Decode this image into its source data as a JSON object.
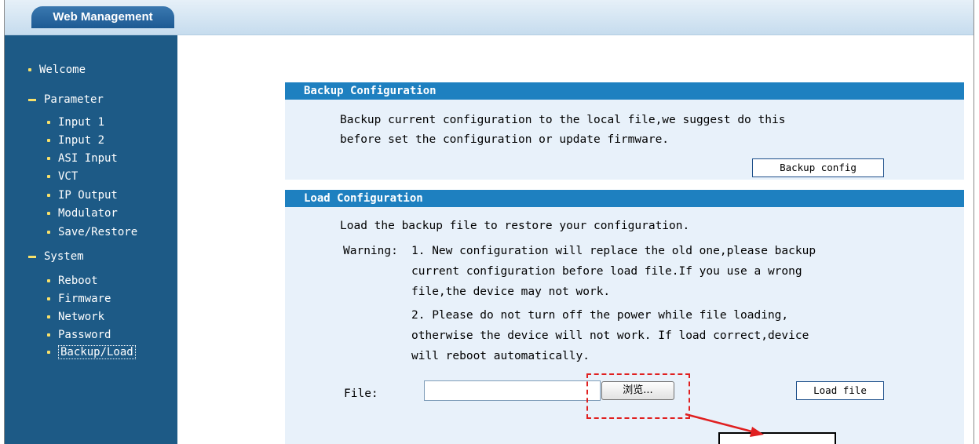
{
  "header": {
    "brand": "Web Management"
  },
  "sidebar": {
    "welcome": "Welcome",
    "parameter": "Parameter",
    "parameter_items": [
      "Input 1",
      "Input 2",
      "ASI Input",
      "VCT",
      "IP Output",
      "Modulator",
      "Save/Restore"
    ],
    "system": "System",
    "system_items": [
      "Reboot",
      "Firmware",
      "Network",
      "Password",
      "Backup/Load"
    ],
    "active": "Backup/Load"
  },
  "backup": {
    "title": "Backup Configuration",
    "line1": "Backup current configuration to the local file,we suggest do this",
    "line2": "before set the configuration or update firmware.",
    "button": "Backup config"
  },
  "load": {
    "title": "Load Configuration",
    "intro": "Load the backup file to restore your configuration.",
    "warning_label": "Warning:",
    "w1_line1": "1. New configuration will replace the old one,please backup",
    "w1_line2": "current configuration before load file.If you use a wrong",
    "w1_line3": "file,the device may not work.",
    "w2_line1": "2. Please do not turn off the power while file loading,",
    "w2_line2": "otherwise the device will not work. If load correct,device",
    "w2_line3": "will reboot automatically.",
    "file_label": "File:",
    "file_value": "",
    "browse_button": "浏览...",
    "load_button": "Load file"
  },
  "annotation": {
    "color": "#e02020"
  }
}
